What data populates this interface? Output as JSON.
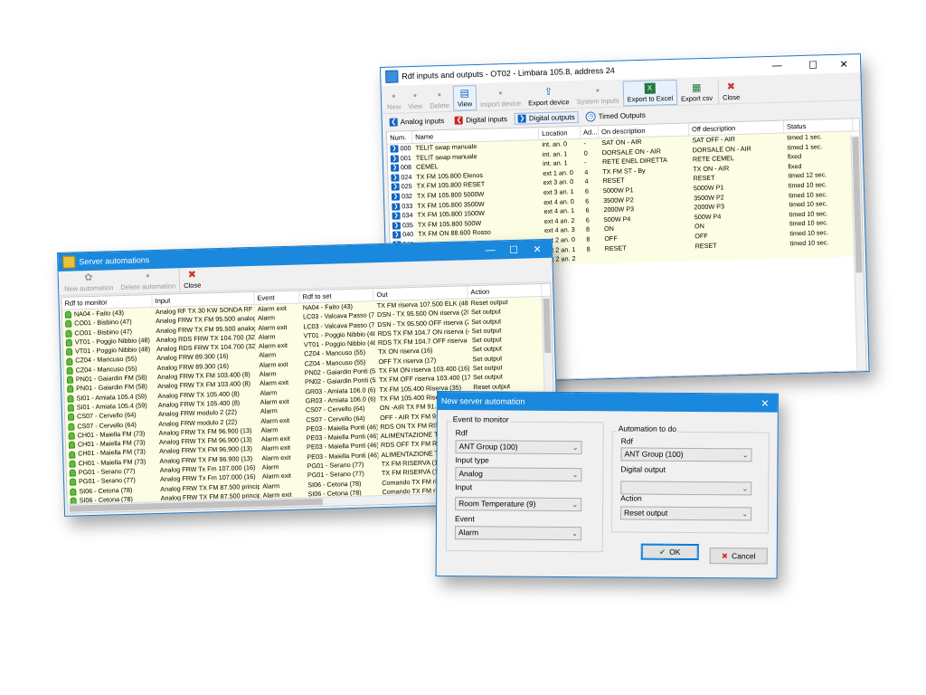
{
  "win_io": {
    "title": "Rdf inputs and outputs - OT02 - Limbara 105.8, address 24",
    "toolbar": [
      {
        "label": "New",
        "icon": "new-icon",
        "enabled": false
      },
      {
        "label": "View",
        "icon": "view-icon",
        "enabled": false
      },
      {
        "label": "Delete",
        "icon": "delete-icon",
        "enabled": false
      },
      {
        "label": "View",
        "icon": "view-icon",
        "enabled": true
      },
      {
        "label": "Import device",
        "icon": "import-icon",
        "enabled": false
      },
      {
        "label": "Export device",
        "icon": "export-icon",
        "enabled": true
      },
      {
        "label": "System inputs",
        "icon": "system-inputs-icon",
        "enabled": false
      },
      {
        "label": "Export to Excel",
        "icon": "excel-icon",
        "enabled": true
      },
      {
        "label": "Export csv",
        "icon": "csv-icon",
        "enabled": true
      },
      {
        "label": "Close",
        "icon": "close-icon",
        "enabled": true
      }
    ],
    "tabs": [
      {
        "label": "Analog inputs",
        "color": "#1565c0",
        "active": false
      },
      {
        "label": "Digital inputs",
        "color": "#c62828",
        "active": false
      },
      {
        "label": "Digital outputs",
        "color": "#1565c0",
        "active": true
      },
      {
        "label": "Timed Outputs",
        "color": "#1565c0",
        "active": false
      }
    ],
    "columns": [
      "Num.",
      "Name",
      "Location",
      "Ad...",
      "On description",
      "Off description",
      "Status"
    ],
    "rows": [
      {
        "num": "000",
        "name": "TELIT swap manuale",
        "loc": "int. an. 0",
        "ad": "-",
        "on": "SAT ON - AIR",
        "off": "SAT OFF - AIR",
        "status": "timed 1 sec."
      },
      {
        "num": "001",
        "name": "TELIT swap manuale",
        "loc": "int. an. 1",
        "ad": "0",
        "on": "DORSALE ON - AIR",
        "off": "DORSALE ON - AIR",
        "status": "timed 1 sec."
      },
      {
        "num": "008",
        "name": "CEMEL",
        "loc": "int. an. 1",
        "ad": "-",
        "on": "RETE ENEL DIRETTA",
        "off": "RETE CEMEL",
        "status": "fixed"
      },
      {
        "num": "024",
        "name": "TX FM 105.800 Elenos",
        "loc": "ext 1 an. 0",
        "ad": "4",
        "on": "TX FM ST - By",
        "off": "TX ON - AIR",
        "status": "fixed"
      },
      {
        "num": "025",
        "name": "TX FM 105.800 RESET",
        "loc": "ext 3 an. 0",
        "ad": "4",
        "on": "RESET",
        "off": "RESET",
        "status": "timed 12 sec."
      },
      {
        "num": "032",
        "name": "TX FM 105.800  5000W",
        "loc": "ext 3 an. 1",
        "ad": "6",
        "on": "5000W P1",
        "off": "5000W P1",
        "status": "timed 10 sec."
      },
      {
        "num": "033",
        "name": "TX FM 105.800 3500W",
        "loc": "ext 4 an. 0",
        "ad": "6",
        "on": "3500W P2",
        "off": "3500W P2",
        "status": "timed 10 sec."
      },
      {
        "num": "034",
        "name": "TX FM 105.800 1500W",
        "loc": "ext 4 an. 1",
        "ad": "6",
        "on": "2000W P3",
        "off": "2000W P3",
        "status": "timed 10 sec."
      },
      {
        "num": "035",
        "name": "TX FM 105.800 500W",
        "loc": "ext 4 an. 2",
        "ad": "6",
        "on": "500W P4",
        "off": "500W P4",
        "status": "timed 10 sec."
      },
      {
        "num": "040",
        "name": "TX FM ON  88.600 Rosso",
        "loc": "ext 4 an. 3",
        "ad": "8",
        "on": "ON",
        "off": "ON",
        "status": "timed 10 sec."
      },
      {
        "num": "041",
        "name": "",
        "loc": "ext 2 an. 0",
        "ad": "8",
        "on": "OFF",
        "off": "OFF",
        "status": "timed 10 sec."
      },
      {
        "num": "042",
        "name": "",
        "loc": "ext 2 an. 1",
        "ad": "8",
        "on": "RESET",
        "off": "RESET",
        "status": "timed 10 sec."
      },
      {
        "num": "043",
        "name": "",
        "loc": "ext 2 an. 2",
        "ad": "",
        "on": "",
        "off": "",
        "status": ""
      }
    ]
  },
  "win_srv": {
    "title": "Server automations",
    "toolbar": [
      {
        "label": "New automation",
        "icon": "new-automation-icon",
        "enabled": false
      },
      {
        "label": "Delete automation",
        "icon": "delete-automation-icon",
        "enabled": false
      },
      {
        "label": "Close",
        "icon": "close-icon",
        "enabled": true
      }
    ],
    "columns": [
      "Rdf to monitor",
      "Input",
      "Event",
      "Rdf to set",
      "Out",
      "Action"
    ],
    "rows": [
      {
        "rdf": "NA04 - Faito (43)",
        "input": "Analog RF  TX 30 KW  SONDA  RF T...",
        "event": "Alarm exit",
        "set": "NA04 - Faito (43)",
        "out": "TX FM riserva 107.500 ELK (48)",
        "action": "Reset output"
      },
      {
        "rdf": "CO01 - Bisbino (47)",
        "input": "Analog FRW TX FM 95.500 analog (...",
        "event": "Alarm",
        "set": "LC03 - Valcava Passo (72)",
        "out": "DSN - TX  95.500 ON riserva (20)",
        "action": "Set output"
      },
      {
        "rdf": "CO01 - Bisbino (47)",
        "input": "Analog FRW TX FM 95.500 analog (...",
        "event": "Alarm exit",
        "set": "LC03 - Valcava Passo (72)",
        "out": "DSN - TX  95.500 OFF riserva (22)",
        "action": "Set output"
      },
      {
        "rdf": "VT01 - Poggio Nibbio (48)",
        "input": "Analog RDS FRW TX 104.700 (32)",
        "event": "Alarm",
        "set": "VT01 - Poggio Nibbio (48)",
        "out": "RDS TX FM 104.7 ON riserva (48)",
        "action": "Set output"
      },
      {
        "rdf": "VT01 - Poggio Nibbio (48)",
        "input": "Analog RDS FRW TX 104.700 (32)",
        "event": "Alarm exit",
        "set": "VT01 - Poggio Nibbio (48)",
        "out": "RDS TX FM 104.7 OFF riserva (49)",
        "action": "Set output"
      },
      {
        "rdf": "CZ04 -  Mancuso (55)",
        "input": "Analog FRW 89.300 (16)",
        "event": "Alarm",
        "set": "CZ04 -  Mancuso (55)",
        "out": "TX ON riserva (16)",
        "action": "Set output"
      },
      {
        "rdf": "CZ04 -  Mancuso (55)",
        "input": "Analog FRW 89.300 (16)",
        "event": "Alarm exit",
        "set": "CZ04 -  Mancuso (55)",
        "out": "OFF TX  riserva (17)",
        "action": "Set output"
      },
      {
        "rdf": "PN01 - Gaiardin FM (58)",
        "input": "Analog FRW TX FM 103.400 (8)",
        "event": "Alarm",
        "set": "PN02 - Gaiardin Ponti (53)",
        "out": "TX FM ON  riserva 103.400 (16)",
        "action": "Set output"
      },
      {
        "rdf": "PN01 - Gaiardin FM (58)",
        "input": "Analog FRW TX FM 103.400 (8)",
        "event": "Alarm exit",
        "set": "PN02 - Gaiardin Ponti (53)",
        "out": "TX FM OFF riserva 103.400 (17)",
        "action": "Set output"
      },
      {
        "rdf": "SI01 - Amiata 105.4 (59)",
        "input": "Analog FRW TX 105.400 (8)",
        "event": "Alarm",
        "set": "GR03 - Amiata 106.0 (6)",
        "out": "TX FM 105.400 Riserva (35)",
        "action": "Reset output"
      },
      {
        "rdf": "SI01 - Amiata 105.4 (59)",
        "input": "Analog FRW TX 105.400 (8)",
        "event": "Alarm exit",
        "set": "GR03 - Amiata 106.0 (6)",
        "out": "TX FM 105.400 Riserva (35)",
        "action": "Set output"
      },
      {
        "rdf": "CS07 - Cervello (64)",
        "input": "Analog FRW  modulo  2 (22)",
        "event": "Alarm",
        "set": "CS07 - Cervello (64)",
        "out": "ON -AIR TX  FM  91.800 riserva",
        "action": ""
      },
      {
        "rdf": "CS07 - Cervello (64)",
        "input": "Analog FRW  modulo  2 (22)",
        "event": "Alarm exit",
        "set": "CS07 - Cervello (64)",
        "out": "OFF - AIR TX FM 91.800 ris...",
        "action": ""
      },
      {
        "rdf": "CH01 - Maiella FM (73)",
        "input": "Analog FRW TX FM 96.900 (13)",
        "event": "Alarm",
        "set": "PE03 - Maiella Ponti (46)",
        "out": "RDS ON TX FM RISERVA",
        "action": ""
      },
      {
        "rdf": "CH01 - Maiella FM (73)",
        "input": "Analog FRW TX FM 96.900 (13)",
        "event": "Alarm exit",
        "set": "PE03 - Maiella Ponti (46)",
        "out": "ALIMENTAZIONE TX RISE...",
        "action": ""
      },
      {
        "rdf": "CH01 - Maiella FM (73)",
        "input": "Analog FRW TX FM 96.900 (13)",
        "event": "Alarm exit",
        "set": "PE03 - Maiella Ponti (46)",
        "out": "RDS OFF TX FM RISERVA",
        "action": ""
      },
      {
        "rdf": "CH01 - Maiella FM (73)",
        "input": "Analog FRW TX FM 96.900 (13)",
        "event": "Alarm exit",
        "set": "PE03 - Maiella Ponti (46)",
        "out": "ALIMENTAZIONE TX RISE...",
        "action": ""
      },
      {
        "rdf": "PG01 - Serano (77)",
        "input": "Analog FRW Tx Fm 107.000 (16)",
        "event": "Alarm",
        "set": "PG01 - Serano (77)",
        "out": "TX FM RISERVA (18)",
        "action": ""
      },
      {
        "rdf": "PG01 - Serano (77)",
        "input": "Analog FRW Tx Fm 107.000 (16)",
        "event": "Alarm exit",
        "set": "PG01 - Serano (77)",
        "out": "TX FM RISERVA (18)",
        "action": ""
      },
      {
        "rdf": "SI06 - Cetona (78)",
        "input": "Analog FRW TX FM 87.500 principa...",
        "event": "Alarm",
        "set": "SI06 - Cetona (78)",
        "out": "Comando TX FM riserva",
        "action": ""
      },
      {
        "rdf": "SI06 - Cetona (78)",
        "input": "Analog FRW TX FM 87.500 principa...",
        "event": "Alarm exit",
        "set": "SI06 - Cetona (78)",
        "out": "Comando TX FM riserva",
        "action": ""
      }
    ]
  },
  "win_new": {
    "title": "New server automation",
    "event_group": "Event to monitor",
    "auto_group": "Automation to do",
    "rdf_label": "Rdf",
    "rdf_value": "ANT Group (100)",
    "input_type_label": "Input type",
    "input_type_value": "Analog",
    "input_label": "Input",
    "input_value": "Room Temperature (9)",
    "event_label": "Event",
    "event_value": "Alarm",
    "rdf2_label": "Rdf",
    "rdf2_value": "ANT Group (100)",
    "digital_output_label": "Digital output",
    "digital_output_value": "",
    "action_label": "Action",
    "action_value": "Reset output",
    "ok_label": "OK",
    "cancel_label": "Cancel"
  }
}
